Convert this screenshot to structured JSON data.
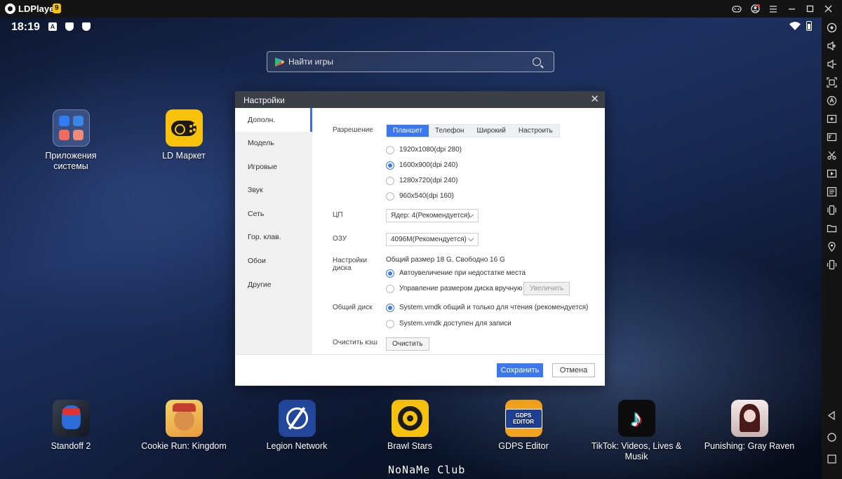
{
  "window": {
    "title": "LDPlayer",
    "version": "9"
  },
  "status_bar": {
    "time": "18:19",
    "icons": [
      "a-icon",
      "shield-icon",
      "shield-icon"
    ],
    "right_icons": [
      "wifi-icon",
      "battery-icon"
    ]
  },
  "search": {
    "placeholder": "Найти игры"
  },
  "desktop_apps": [
    {
      "label": "Приложения системы",
      "icon": "system-apps-folder-icon"
    },
    {
      "label": "LD Маркет",
      "icon": "ld-market-icon"
    }
  ],
  "dock_apps": [
    {
      "label": "Standoff 2",
      "icon": "standoff2-icon"
    },
    {
      "label": "Cookie Run: Kingdom",
      "icon": "cookie-run-icon"
    },
    {
      "label": "Legion Network",
      "icon": "legion-network-icon"
    },
    {
      "label": "Brawl Stars",
      "icon": "brawl-stars-icon"
    },
    {
      "label": "GDPS Editor",
      "icon": "gdps-editor-icon",
      "icon_text": "GDPS EDITOR"
    },
    {
      "label": "TikTok: Videos, Lives & Musik",
      "icon": "tiktok-icon"
    },
    {
      "label": "Punishing: Gray Raven",
      "icon": "punishing-gray-raven-icon"
    }
  ],
  "watermark": "NoNaMe Club",
  "settings": {
    "title": "Настройки",
    "sidebar": [
      {
        "label": "Дополн.",
        "active": true
      },
      {
        "label": "Модель",
        "active": false
      },
      {
        "label": "Игровые",
        "active": false
      },
      {
        "label": "Звук",
        "active": false
      },
      {
        "label": "Сеть",
        "active": false
      },
      {
        "label": "Гор. клав.",
        "active": false
      },
      {
        "label": "Обои",
        "active": false
      },
      {
        "label": "Другие",
        "active": false
      }
    ],
    "resolution": {
      "label": "Разрешение",
      "tabs": [
        "Планшет",
        "Телефон",
        "Широкий",
        "Настроить"
      ],
      "selected_tab": "Планшет",
      "options": [
        {
          "label": "1920x1080(dpi 280)",
          "selected": false
        },
        {
          "label": "1600x900(dpi 240)",
          "selected": true
        },
        {
          "label": "1280x720(dpi 240)",
          "selected": false
        },
        {
          "label": "960x540(dpi 160)",
          "selected": false
        }
      ]
    },
    "cpu": {
      "label": "ЦП",
      "value": "Ядер: 4(Рекомендуется)"
    },
    "ram": {
      "label": "ОЗУ",
      "value": "4096M(Рекомендуется)"
    },
    "disk": {
      "label_line1": "Настройки",
      "label_line2": "диска",
      "info": "Общий размер 18 G, Свободно 16 G",
      "options": [
        {
          "label": "Автоувеличение при недостатке места",
          "selected": true
        },
        {
          "label": "Управление размером диска вручную",
          "selected": false
        }
      ],
      "increase_button": "Увеличить"
    },
    "shared_disk": {
      "label": "Общий диск",
      "options": [
        {
          "label": "System.vmdk общий и только для чтения (рекомендуется)",
          "selected": true
        },
        {
          "label": "System.vmdk доступен для записи",
          "selected": false
        }
      ]
    },
    "cache": {
      "label": "Очистить кэш",
      "button": "Очистить"
    },
    "save_button": "Сохранить",
    "cancel_button": "Отмена"
  },
  "toolbar": [
    "gamepad-icon",
    "volume-up-icon",
    "volume-down-icon",
    "screenshot-icon",
    "autoclick-icon",
    "add-window-icon",
    "fps-icon",
    "cut-icon",
    "video-icon",
    "operations-record-icon",
    "shake-icon",
    "folder-icon",
    "location-icon",
    "rotate-icon",
    "back-icon",
    "home-icon",
    "recent-apps-icon"
  ],
  "colors": {
    "accent": "#3b78f0",
    "titlebar": "#141414",
    "dialog_header": "#3b3f46"
  }
}
